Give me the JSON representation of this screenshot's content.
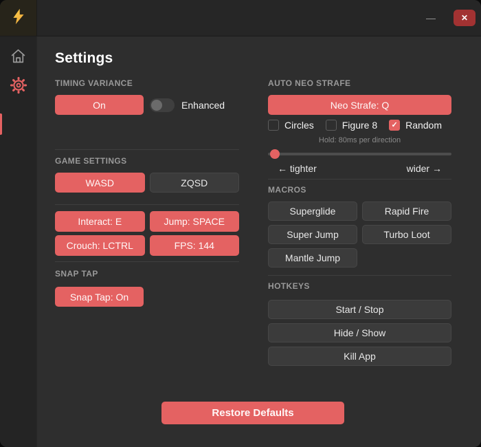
{
  "window": {
    "controls": {
      "minimize": "—",
      "close": "✕"
    }
  },
  "icons": {
    "logo": "lightning-bolt",
    "nav_home": "home",
    "nav_settings": "gear"
  },
  "colors": {
    "accent": "#e46262",
    "close_button": "#a23232",
    "bolt_yellow": "#f7c843",
    "panel_bg": "#2e2e2e"
  },
  "page": {
    "title": "Settings"
  },
  "timing_variance": {
    "label": "TIMING VARIANCE",
    "on_button": "On",
    "toggle_label": "Enhanced"
  },
  "game_settings": {
    "label": "GAME SETTINGS",
    "layouts": [
      "WASD",
      "ZQSD"
    ],
    "keybinds": [
      "Interact: E",
      "Jump: SPACE",
      "Crouch: LCTRL",
      "FPS: 144"
    ]
  },
  "snap_tap": {
    "label": "SNAP TAP",
    "button": "Snap Tap: On"
  },
  "auto_neo_strafe": {
    "label": "AUTO NEO STRAFE",
    "key_button": "Neo Strafe: Q",
    "modes": [
      {
        "label": "Circles",
        "checked": false
      },
      {
        "label": "Figure 8",
        "checked": false
      },
      {
        "label": "Random",
        "checked": true
      }
    ],
    "check_glyph": "✓",
    "hold_text": "Hold: 80ms per direction",
    "slider": {
      "left_label": "← tighter",
      "right_label": "wider →",
      "position_pct": 1
    }
  },
  "macros": {
    "label": "MACROS",
    "buttons": [
      "Superglide",
      "Rapid Fire",
      "Super Jump",
      "Turbo Loot",
      "Mantle Jump"
    ]
  },
  "hotkeys": {
    "label": "HOTKEYS",
    "buttons": [
      "Start / Stop",
      "Hide / Show",
      "Kill App"
    ]
  },
  "footer": {
    "restore_button": "Restore Defaults"
  }
}
